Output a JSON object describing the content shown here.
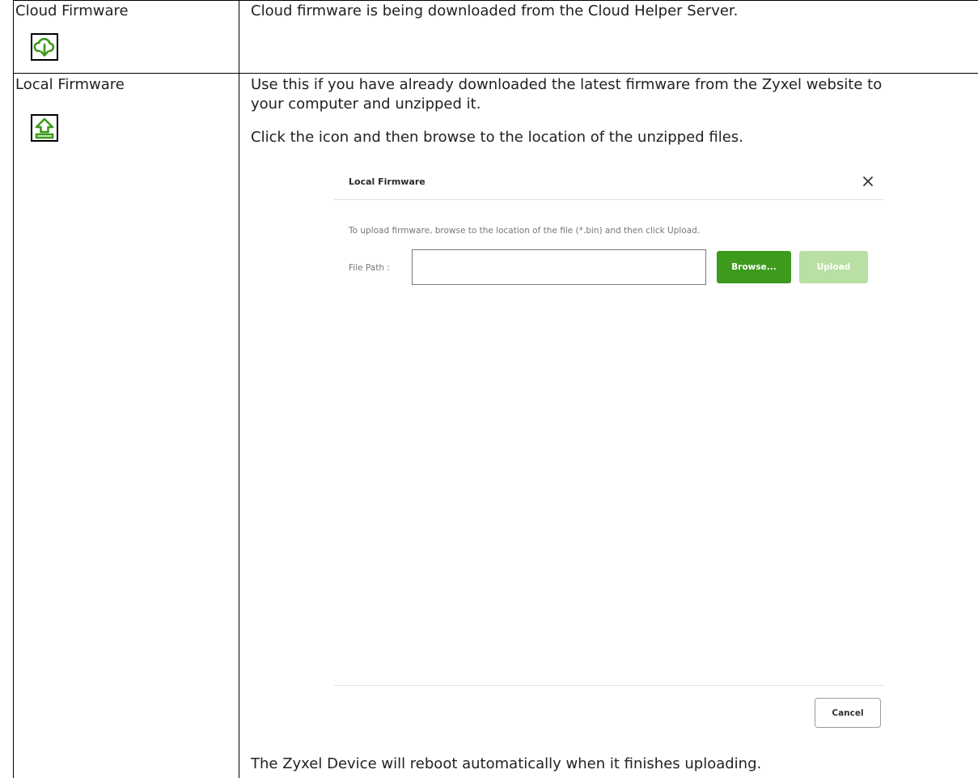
{
  "rows": [
    {
      "name": "Cloud Firmware",
      "icon": "cloud-download-icon",
      "description": "Cloud firmware is being downloaded from the Cloud Helper Server."
    },
    {
      "name": "Local Firmware",
      "icon": "upload-icon",
      "description_line1": "Use this if you have already downloaded the latest firmware from the Zyxel website to",
      "description_line2": "your computer and unzipped it.",
      "instruction": "Click the icon and then browse to the location of the unzipped files.",
      "footer_note": "The Zyxel Device will reboot automatically when it finishes uploading."
    }
  ],
  "dialog": {
    "title": "Local Firmware",
    "close_icon": "close-icon",
    "description": "To upload firmware, browse to the location of the file (*.bin) and then click Upload.",
    "file_path_label": "File Path :",
    "file_path_value": "",
    "browse_label": "Browse...",
    "upload_label": "Upload",
    "cancel_label": "Cancel"
  },
  "colors": {
    "icon_green": "#3c9a1c",
    "browse_green": "#3c9a1c",
    "upload_disabled_green": "#b9dfa3"
  }
}
